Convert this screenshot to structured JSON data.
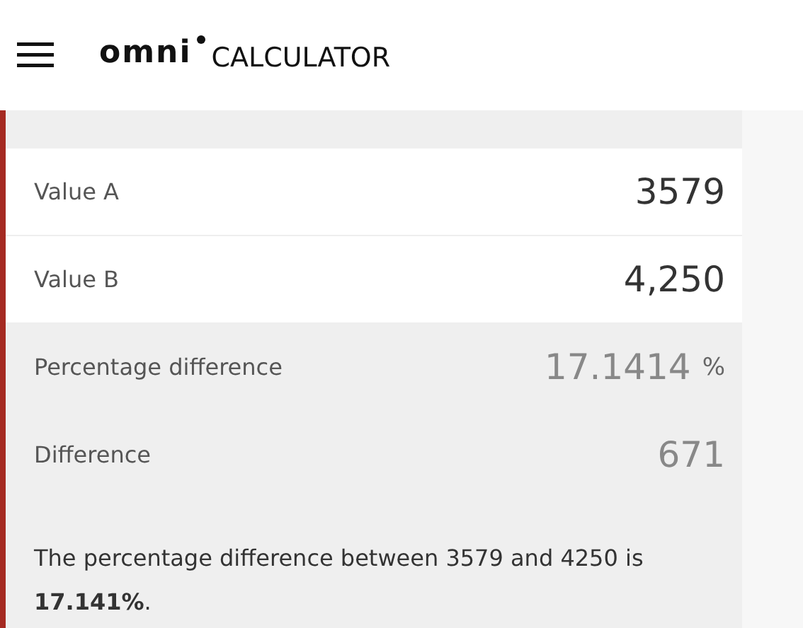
{
  "header": {
    "logo_word": "omni",
    "logo_text": "CALCULATOR"
  },
  "rows": [
    {
      "kind": "input",
      "label": "Value A",
      "value": "3579"
    },
    {
      "kind": "input",
      "label": "Value B",
      "value": "4,250"
    },
    {
      "kind": "output",
      "label": "Percentage difference",
      "value": "17.1414",
      "unit": "%"
    },
    {
      "kind": "output",
      "label": "Difference",
      "value": "671"
    }
  ],
  "summary": "The percentage difference between 3579 and 4250 is **17.141%**."
}
